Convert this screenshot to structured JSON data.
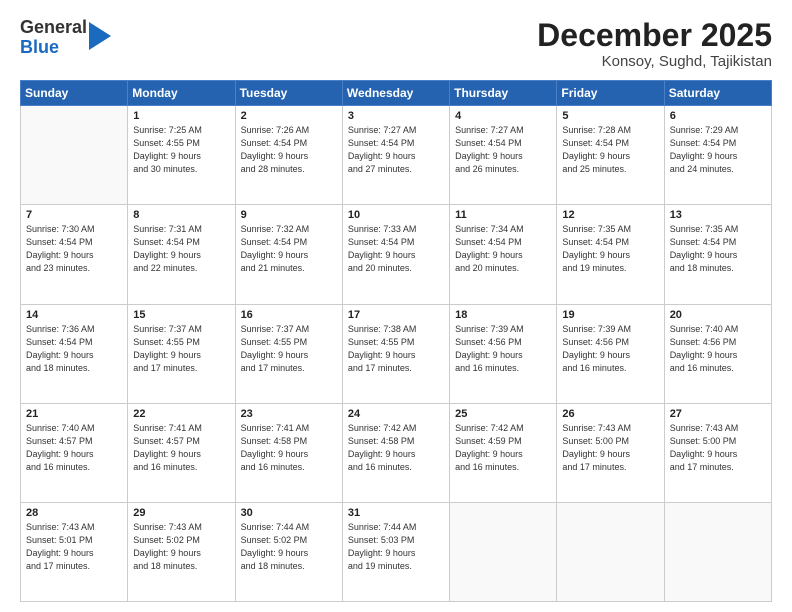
{
  "logo": {
    "general": "General",
    "blue": "Blue"
  },
  "title": "December 2025",
  "location": "Konsoy, Sughd, Tajikistan",
  "days_header": [
    "Sunday",
    "Monday",
    "Tuesday",
    "Wednesday",
    "Thursday",
    "Friday",
    "Saturday"
  ],
  "weeks": [
    [
      {
        "day": "",
        "info": ""
      },
      {
        "day": "1",
        "info": "Sunrise: 7:25 AM\nSunset: 4:55 PM\nDaylight: 9 hours\nand 30 minutes."
      },
      {
        "day": "2",
        "info": "Sunrise: 7:26 AM\nSunset: 4:54 PM\nDaylight: 9 hours\nand 28 minutes."
      },
      {
        "day": "3",
        "info": "Sunrise: 7:27 AM\nSunset: 4:54 PM\nDaylight: 9 hours\nand 27 minutes."
      },
      {
        "day": "4",
        "info": "Sunrise: 7:27 AM\nSunset: 4:54 PM\nDaylight: 9 hours\nand 26 minutes."
      },
      {
        "day": "5",
        "info": "Sunrise: 7:28 AM\nSunset: 4:54 PM\nDaylight: 9 hours\nand 25 minutes."
      },
      {
        "day": "6",
        "info": "Sunrise: 7:29 AM\nSunset: 4:54 PM\nDaylight: 9 hours\nand 24 minutes."
      }
    ],
    [
      {
        "day": "7",
        "info": "Sunrise: 7:30 AM\nSunset: 4:54 PM\nDaylight: 9 hours\nand 23 minutes."
      },
      {
        "day": "8",
        "info": "Sunrise: 7:31 AM\nSunset: 4:54 PM\nDaylight: 9 hours\nand 22 minutes."
      },
      {
        "day": "9",
        "info": "Sunrise: 7:32 AM\nSunset: 4:54 PM\nDaylight: 9 hours\nand 21 minutes."
      },
      {
        "day": "10",
        "info": "Sunrise: 7:33 AM\nSunset: 4:54 PM\nDaylight: 9 hours\nand 20 minutes."
      },
      {
        "day": "11",
        "info": "Sunrise: 7:34 AM\nSunset: 4:54 PM\nDaylight: 9 hours\nand 20 minutes."
      },
      {
        "day": "12",
        "info": "Sunrise: 7:35 AM\nSunset: 4:54 PM\nDaylight: 9 hours\nand 19 minutes."
      },
      {
        "day": "13",
        "info": "Sunrise: 7:35 AM\nSunset: 4:54 PM\nDaylight: 9 hours\nand 18 minutes."
      }
    ],
    [
      {
        "day": "14",
        "info": "Sunrise: 7:36 AM\nSunset: 4:54 PM\nDaylight: 9 hours\nand 18 minutes."
      },
      {
        "day": "15",
        "info": "Sunrise: 7:37 AM\nSunset: 4:55 PM\nDaylight: 9 hours\nand 17 minutes."
      },
      {
        "day": "16",
        "info": "Sunrise: 7:37 AM\nSunset: 4:55 PM\nDaylight: 9 hours\nand 17 minutes."
      },
      {
        "day": "17",
        "info": "Sunrise: 7:38 AM\nSunset: 4:55 PM\nDaylight: 9 hours\nand 17 minutes."
      },
      {
        "day": "18",
        "info": "Sunrise: 7:39 AM\nSunset: 4:56 PM\nDaylight: 9 hours\nand 16 minutes."
      },
      {
        "day": "19",
        "info": "Sunrise: 7:39 AM\nSunset: 4:56 PM\nDaylight: 9 hours\nand 16 minutes."
      },
      {
        "day": "20",
        "info": "Sunrise: 7:40 AM\nSunset: 4:56 PM\nDaylight: 9 hours\nand 16 minutes."
      }
    ],
    [
      {
        "day": "21",
        "info": "Sunrise: 7:40 AM\nSunset: 4:57 PM\nDaylight: 9 hours\nand 16 minutes."
      },
      {
        "day": "22",
        "info": "Sunrise: 7:41 AM\nSunset: 4:57 PM\nDaylight: 9 hours\nand 16 minutes."
      },
      {
        "day": "23",
        "info": "Sunrise: 7:41 AM\nSunset: 4:58 PM\nDaylight: 9 hours\nand 16 minutes."
      },
      {
        "day": "24",
        "info": "Sunrise: 7:42 AM\nSunset: 4:58 PM\nDaylight: 9 hours\nand 16 minutes."
      },
      {
        "day": "25",
        "info": "Sunrise: 7:42 AM\nSunset: 4:59 PM\nDaylight: 9 hours\nand 16 minutes."
      },
      {
        "day": "26",
        "info": "Sunrise: 7:43 AM\nSunset: 5:00 PM\nDaylight: 9 hours\nand 17 minutes."
      },
      {
        "day": "27",
        "info": "Sunrise: 7:43 AM\nSunset: 5:00 PM\nDaylight: 9 hours\nand 17 minutes."
      }
    ],
    [
      {
        "day": "28",
        "info": "Sunrise: 7:43 AM\nSunset: 5:01 PM\nDaylight: 9 hours\nand 17 minutes."
      },
      {
        "day": "29",
        "info": "Sunrise: 7:43 AM\nSunset: 5:02 PM\nDaylight: 9 hours\nand 18 minutes."
      },
      {
        "day": "30",
        "info": "Sunrise: 7:44 AM\nSunset: 5:02 PM\nDaylight: 9 hours\nand 18 minutes."
      },
      {
        "day": "31",
        "info": "Sunrise: 7:44 AM\nSunset: 5:03 PM\nDaylight: 9 hours\nand 19 minutes."
      },
      {
        "day": "",
        "info": ""
      },
      {
        "day": "",
        "info": ""
      },
      {
        "day": "",
        "info": ""
      }
    ]
  ]
}
